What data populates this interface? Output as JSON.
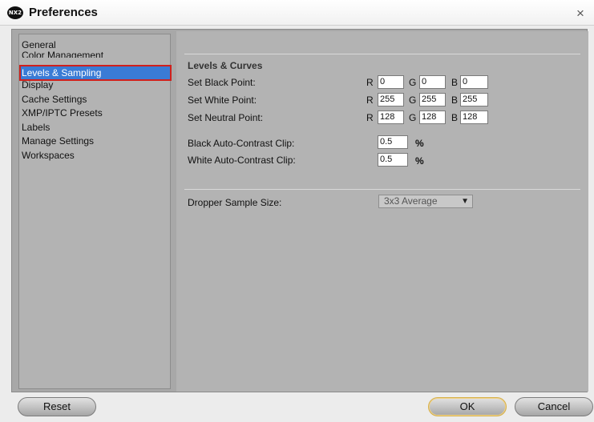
{
  "window": {
    "title": "Preferences",
    "app_icon": "NX2",
    "close_glyph": "×"
  },
  "sidebar": {
    "items": [
      {
        "label": "General"
      },
      {
        "label": "Color Management"
      },
      {
        "label": "Levels & Sampling",
        "selected": true
      },
      {
        "label": "Display"
      },
      {
        "label": "Cache Settings"
      },
      {
        "label": "XMP/IPTC Presets"
      },
      {
        "label": "Labels"
      },
      {
        "label": "Manage Settings"
      },
      {
        "label": "Workspaces"
      }
    ]
  },
  "levels": {
    "heading": "Levels & Curves",
    "channel_labels": {
      "r": "R",
      "g": "G",
      "b": "B"
    },
    "black_point": {
      "label": "Set Black Point:",
      "r": "0",
      "g": "0",
      "b": "0"
    },
    "white_point": {
      "label": "Set White Point:",
      "r": "255",
      "g": "255",
      "b": "255"
    },
    "neutral_point": {
      "label": "Set Neutral Point:",
      "r": "128",
      "g": "128",
      "b": "128"
    },
    "black_clip": {
      "label": "Black Auto-Contrast Clip:",
      "value": "0.5",
      "unit": "%"
    },
    "white_clip": {
      "label": "White Auto-Contrast Clip:",
      "value": "0.5",
      "unit": "%"
    }
  },
  "dropper": {
    "label": "Dropper Sample Size:",
    "selected": "3x3 Average",
    "arrow": "▼"
  },
  "buttons": {
    "reset": "Reset",
    "ok": "OK",
    "cancel": "Cancel"
  }
}
